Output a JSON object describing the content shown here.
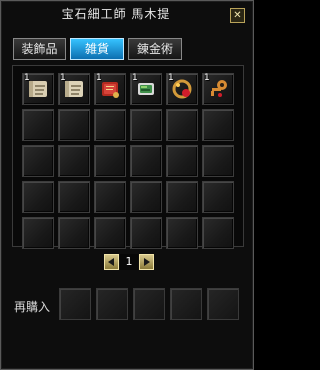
{
  "window": {
    "title": "宝石細工師 馬木提",
    "close_label": "✕"
  },
  "tabs": [
    {
      "label": "装飾品",
      "active": false
    },
    {
      "label": "雑貨",
      "active": true
    },
    {
      "label": "錬金術",
      "active": false
    }
  ],
  "grid": {
    "rows": 5,
    "cols": 6,
    "items": [
      {
        "icon": "scroll-icon",
        "count": "1"
      },
      {
        "icon": "scroll-icon",
        "count": "1"
      },
      {
        "icon": "red-book-icon",
        "count": "1"
      },
      {
        "icon": "green-card-icon",
        "count": "1"
      },
      {
        "icon": "ring-pendant-icon",
        "count": "1"
      },
      {
        "icon": "gem-key-icon",
        "count": "1"
      }
    ]
  },
  "pager": {
    "page": "1"
  },
  "rebuy": {
    "label": "再購入",
    "slots": 5
  },
  "colors": {
    "tab_active": "#36c3ff",
    "frame": "#5a5a5a",
    "gold": "#d8c98c"
  }
}
